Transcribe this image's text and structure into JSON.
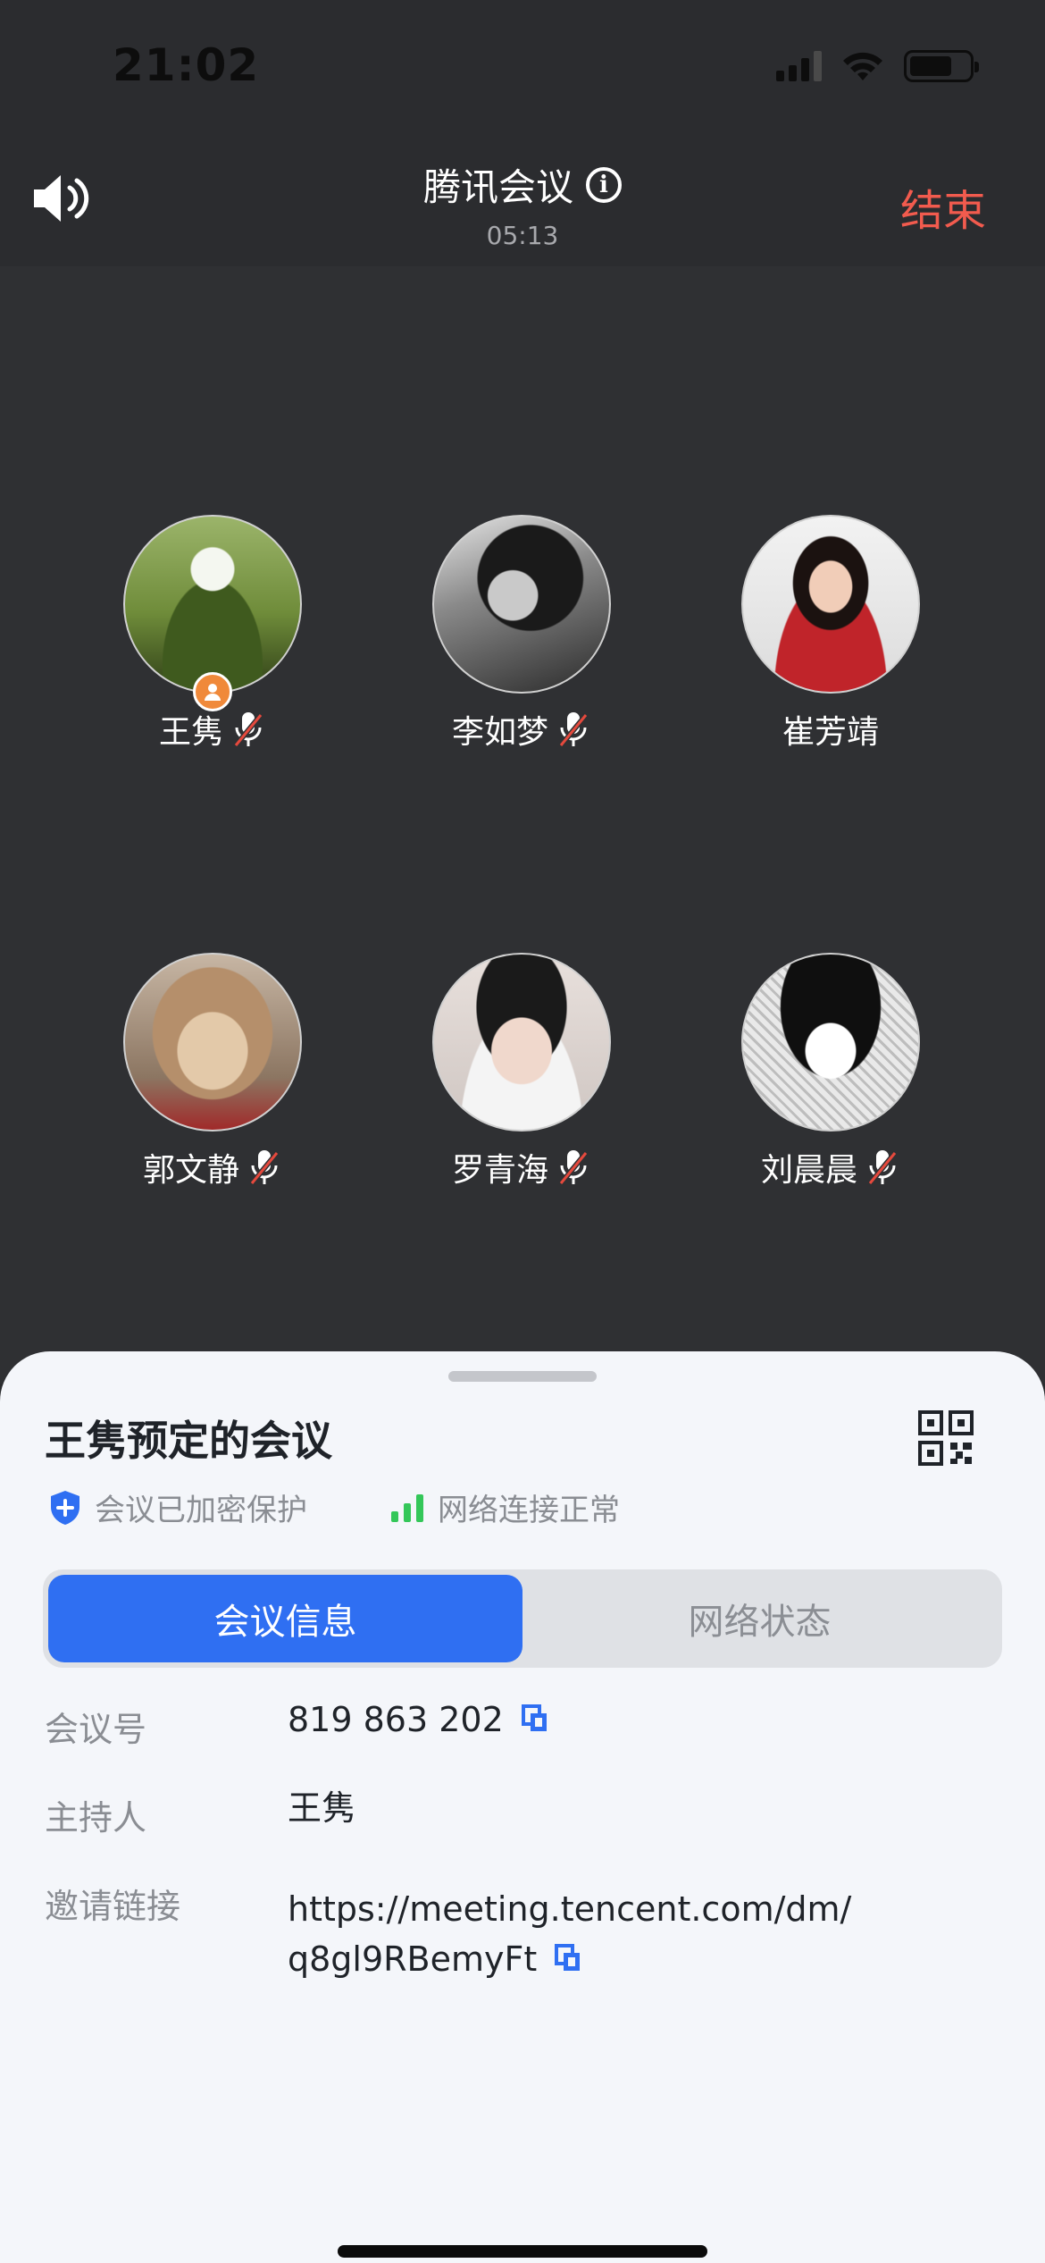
{
  "status_bar": {
    "time": "21:02"
  },
  "header": {
    "title": "腾讯会议",
    "timer": "05:13",
    "end_label": "结束"
  },
  "participants": [
    {
      "name": "王隽",
      "muted": true,
      "host": true
    },
    {
      "name": "李如梦",
      "muted": true,
      "host": false
    },
    {
      "name": "崔芳靖",
      "muted": false,
      "host": false
    },
    {
      "name": "郭文静",
      "muted": true,
      "host": false
    },
    {
      "name": "罗青海",
      "muted": true,
      "host": false
    },
    {
      "name": "刘晨晨",
      "muted": true,
      "host": false
    }
  ],
  "sheet": {
    "title": "王隽预定的会议",
    "encrypted_label": "会议已加密保护",
    "network_label": "网络连接正常",
    "tabs": [
      {
        "label": "会议信息",
        "active": true
      },
      {
        "label": "网络状态",
        "active": false
      }
    ],
    "info": {
      "meeting_id_label": "会议号",
      "meeting_id": "819 863 202",
      "host_label": "主持人",
      "host": "王隽",
      "link_label": "邀请链接",
      "link_line1": "https://meeting.tencent.com/dm/",
      "link_line2": "q8gl9RBemyFt"
    }
  },
  "colors": {
    "accent": "#2f6ff2",
    "end": "#f25b4e",
    "network_good": "#34c759",
    "host_badge": "#f0893a"
  },
  "icons": [
    "speaker-icon",
    "info-icon",
    "mic-off-icon",
    "host-icon",
    "qr-code-icon",
    "shield-icon",
    "signal-bars-icon",
    "copy-icon"
  ]
}
